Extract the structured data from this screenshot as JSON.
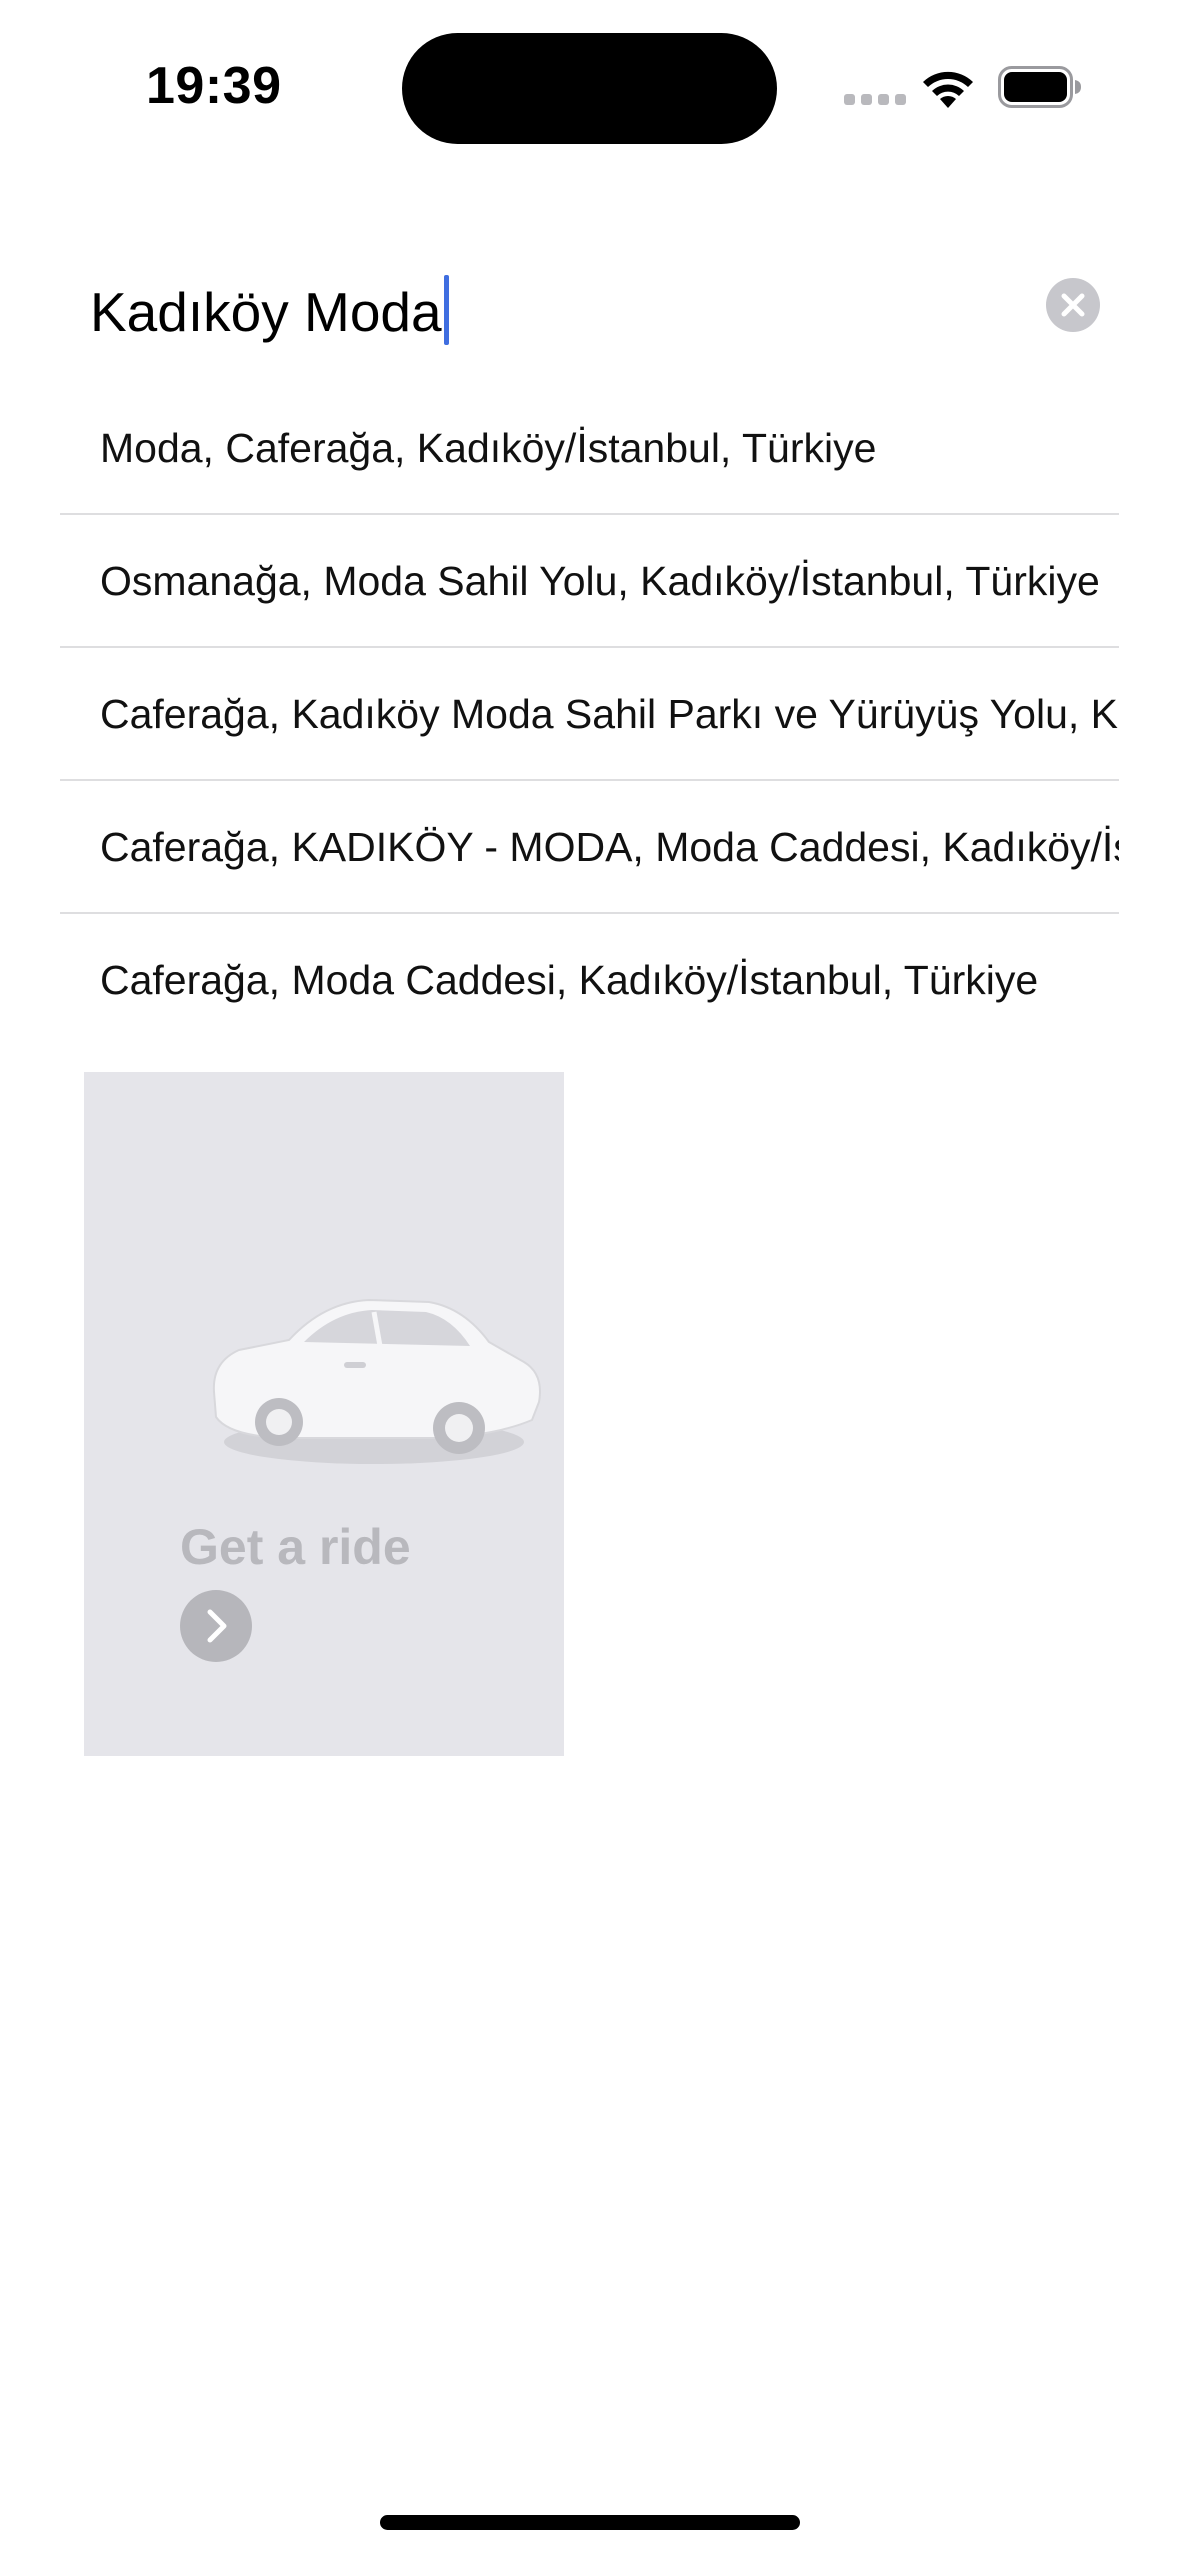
{
  "status_bar": {
    "time": "19:39",
    "icons": [
      "cell-signal-icon",
      "wifi-icon",
      "battery-icon"
    ]
  },
  "search": {
    "value": "Kadıköy Moda",
    "clear_icon": "clear-icon"
  },
  "suggestions": [
    {
      "label": "Moda, Caferağa, Kadıköy/İstanbul, Türkiye"
    },
    {
      "label": "Osmanağa, Moda Sahil Yolu, Kadıköy/İstanbul, Türkiye"
    },
    {
      "label": "Caferağa, Kadıköy Moda Sahil Parkı ve Yürüyüş Yolu, Kadıköy/İstanbul, Türkiye"
    },
    {
      "label": "Caferağa, KADIKÖY - MODA, Moda Caddesi, Kadıköy/İstanbul, Türkiye"
    },
    {
      "label": "Caferağa, Moda Caddesi, Kadıköy/İstanbul, Türkiye"
    }
  ],
  "ride_card": {
    "title": "Get a ride",
    "image": "car-illustration",
    "arrow_icon": "chevron-right-icon"
  },
  "colors": {
    "caret": "#3f6ee0",
    "card_background": "#e5e5ea",
    "card_text": "#b8b8bd",
    "clear_button": "#c7c7cc",
    "divider": "#dedee0"
  }
}
